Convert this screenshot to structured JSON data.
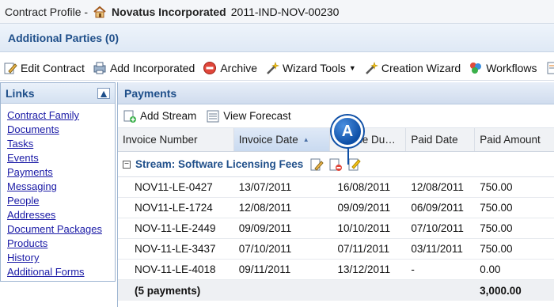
{
  "titlebar": {
    "label": "Contract Profile -",
    "org": "Novatus Incorporated",
    "contract_id": "2011-IND-NOV-00230"
  },
  "subheader": {
    "title": "Additional Parties (0)"
  },
  "toolbar": {
    "items": [
      {
        "label": "Edit Contract",
        "icon": "edit-icon"
      },
      {
        "label": "Add Incorporated",
        "icon": "printer-add-icon"
      },
      {
        "label": "Archive",
        "icon": "stop-icon"
      },
      {
        "label": "Wizard Tools",
        "icon": "wand-icon",
        "dropdown": true
      },
      {
        "label": "Creation Wizard",
        "icon": "wand-icon"
      },
      {
        "label": "Workflows",
        "icon": "workflow-icon"
      }
    ]
  },
  "links": {
    "title": "Links",
    "items": [
      "Contract Family",
      "Documents",
      "Tasks",
      "Events",
      "Payments",
      "Messaging",
      "People",
      "Addresses",
      "Document Packages",
      "Products",
      "History",
      "Additional Forms"
    ]
  },
  "payments": {
    "title": "Payments",
    "tools": {
      "add_stream": "Add Stream",
      "view_forecast": "View Forecast"
    },
    "columns": [
      "Invoice Number",
      "Invoice Date",
      "Invoice Du…",
      "Paid Date",
      "Paid Amount"
    ],
    "sorted_column": "Invoice Date",
    "stream_label": "Stream: Software Licensing Fees",
    "rows": [
      [
        "NOV11-LE-0427",
        "13/07/2011",
        "16/08/2011",
        "12/08/2011",
        "750.00"
      ],
      [
        "NOV11-LE-1724",
        "12/08/2011",
        "09/09/2011",
        "06/09/2011",
        "750.00"
      ],
      [
        "NOV-11-LE-2449",
        "09/09/2011",
        "10/10/2011",
        "07/10/2011",
        "750.00"
      ],
      [
        "NOV-11-LE-3437",
        "07/10/2011",
        "07/11/2011",
        "03/11/2011",
        "750.00"
      ],
      [
        "NOV-11-LE-4018",
        "09/11/2011",
        "13/12/2011",
        "-",
        "0.00"
      ]
    ],
    "summary": {
      "count": "(5 payments)",
      "total": "3,000.00"
    }
  },
  "callout": {
    "letter": "A"
  },
  "colors": {
    "accent": "#1f4f8a",
    "link": "#1a1aa6",
    "callout": "#0e4fa6"
  }
}
